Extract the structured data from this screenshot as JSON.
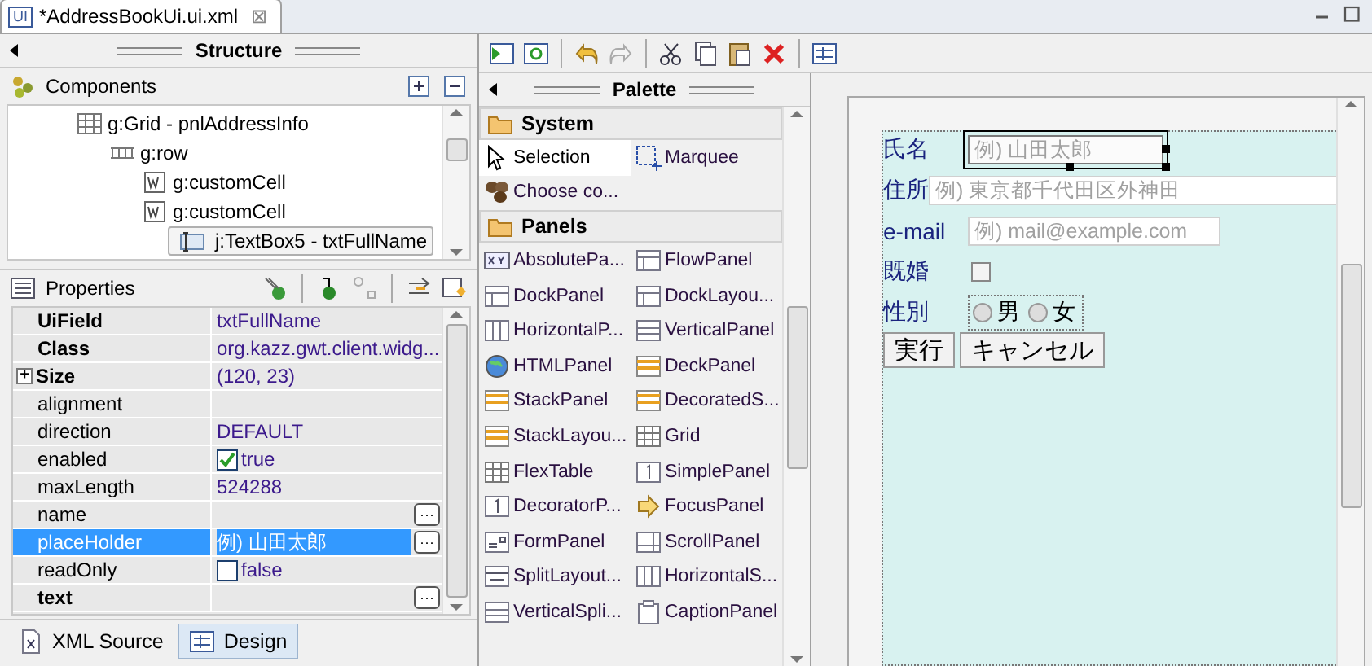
{
  "editor_tab": {
    "badge": "UI",
    "title": "*AddressBookUi.ui.xml",
    "close": "⊠"
  },
  "structure": {
    "title": "Structure",
    "components_title": "Components",
    "tree": [
      {
        "label": "g:Grid - pnlAddressInfo",
        "kind": "grid",
        "selected": false,
        "children": [
          {
            "label": "g:row",
            "kind": "row",
            "selected": false,
            "children": [
              {
                "label": "g:customCell",
                "kind": "cell",
                "selected": false
              },
              {
                "label": "g:customCell",
                "kind": "cell",
                "selected": false,
                "children": [
                  {
                    "label": "j:TextBox5 - txtFullName",
                    "kind": "textbox",
                    "selected": true
                  }
                ]
              }
            ]
          }
        ]
      }
    ]
  },
  "properties": {
    "title": "Properties",
    "rows": [
      {
        "name": "UiField",
        "value": "txtFullName",
        "bold": true,
        "kind": "text",
        "selected": false
      },
      {
        "name": "Class",
        "value": "org.kazz.gwt.client.widg...",
        "bold": true,
        "kind": "text",
        "selected": false
      },
      {
        "name": "Size",
        "value": "(120, 23)",
        "bold": true,
        "kind": "expandable",
        "expander": "+",
        "selected": false
      },
      {
        "name": "alignment",
        "value": "",
        "bold": false,
        "kind": "text",
        "selected": false
      },
      {
        "name": "direction",
        "value": "DEFAULT",
        "bold": false,
        "kind": "text",
        "selected": false
      },
      {
        "name": "enabled",
        "value": "true",
        "bold": false,
        "kind": "checkbox",
        "checked": true,
        "selected": false
      },
      {
        "name": "maxLength",
        "value": "524288",
        "bold": false,
        "kind": "text",
        "selected": false
      },
      {
        "name": "name",
        "value": "",
        "bold": false,
        "kind": "dialog",
        "button": "···",
        "selected": false
      },
      {
        "name": "placeHolder",
        "value": "例) 山田太郎",
        "bold": false,
        "kind": "dialog",
        "button": "···",
        "selected": true
      },
      {
        "name": "readOnly",
        "value": "false",
        "bold": false,
        "kind": "checkbox",
        "checked": false,
        "selected": false
      },
      {
        "name": "text",
        "value": "",
        "bold": true,
        "kind": "dialog",
        "button": "···",
        "selected": false
      }
    ]
  },
  "palette": {
    "title": "Palette",
    "categories": [
      {
        "name": "System",
        "items": [
          {
            "label": "Selection",
            "kind": "arrow",
            "selected": true
          },
          {
            "label": "Marquee",
            "kind": "marquee",
            "selected": false
          },
          {
            "label": "Choose co...",
            "kind": "beans",
            "selected": false
          }
        ]
      },
      {
        "name": "Panels",
        "items": [
          {
            "label": "AbsolutePa...",
            "kind": "xy",
            "selected": false
          },
          {
            "label": "FlowPanel",
            "kind": "flow",
            "selected": false
          },
          {
            "label": "DockPanel",
            "kind": "dock",
            "selected": false
          },
          {
            "label": "DockLayou...",
            "kind": "dock",
            "selected": false
          },
          {
            "label": "HorizontalP...",
            "kind": "hpanel",
            "selected": false
          },
          {
            "label": "VerticalPanel",
            "kind": "vpanel",
            "selected": false
          },
          {
            "label": "HTMLPanel",
            "kind": "globe",
            "selected": false
          },
          {
            "label": "DeckPanel",
            "kind": "stack",
            "selected": false
          },
          {
            "label": "StackPanel",
            "kind": "stack",
            "selected": false
          },
          {
            "label": "DecoratedS...",
            "kind": "stack",
            "selected": false
          },
          {
            "label": "StackLayou...",
            "kind": "stack",
            "selected": false
          },
          {
            "label": "Grid",
            "kind": "grid",
            "selected": false
          },
          {
            "label": "FlexTable",
            "kind": "grid",
            "selected": false
          },
          {
            "label": "SimplePanel",
            "kind": "simple",
            "selected": false
          },
          {
            "label": "DecoratorP...",
            "kind": "simple",
            "selected": false
          },
          {
            "label": "FocusPanel",
            "kind": "focus",
            "selected": false
          },
          {
            "label": "FormPanel",
            "kind": "form",
            "selected": false
          },
          {
            "label": "ScrollPanel",
            "kind": "scroll",
            "selected": false
          },
          {
            "label": "SplitLayout...",
            "kind": "split",
            "selected": false
          },
          {
            "label": "HorizontalS...",
            "kind": "hpanel",
            "selected": false
          },
          {
            "label": "VerticalSpli...",
            "kind": "vpanel",
            "selected": false
          },
          {
            "label": "CaptionPanel",
            "kind": "caption",
            "selected": false
          }
        ]
      }
    ]
  },
  "form": {
    "rows": [
      {
        "label": "氏名",
        "kind": "text",
        "placeholder": "例) 山田太郎",
        "selected": true
      },
      {
        "label": "住所",
        "kind": "text",
        "placeholder": "例) 東京都千代田区外神田",
        "selected": false
      },
      {
        "label": "e-mail",
        "kind": "text",
        "placeholder": "例) mail@example.com",
        "selected": false
      },
      {
        "label": "既婚",
        "kind": "checkbox",
        "checked": false
      },
      {
        "label": "性別",
        "kind": "radio",
        "options": [
          {
            "label": "男",
            "selected": false
          },
          {
            "label": "女",
            "selected": false
          }
        ]
      }
    ],
    "buttons": [
      "実行",
      "キャンセル"
    ]
  },
  "bottom_tabs": [
    {
      "label": "XML Source",
      "kind": "xml",
      "selected": false
    },
    {
      "label": "Design",
      "kind": "design",
      "selected": true
    }
  ]
}
